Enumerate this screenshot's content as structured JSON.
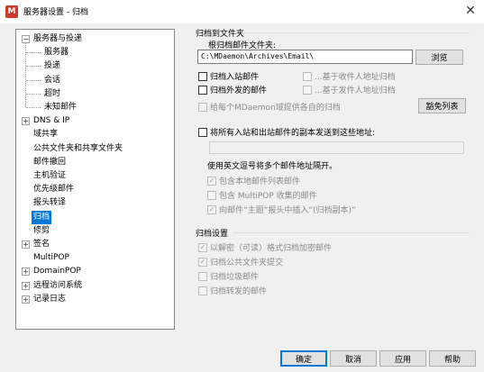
{
  "window": {
    "title": "服务器设置 - 归档",
    "app_icon_glyph": "M",
    "close_glyph": "✕"
  },
  "tree": {
    "expand_glyph": "+",
    "collapse_glyph": "−",
    "items": [
      {
        "label": "服务器与投递",
        "level": 0,
        "expander": "collapse"
      },
      {
        "label": "服务器",
        "level": 1,
        "expander": "none"
      },
      {
        "label": "投递",
        "level": 1,
        "expander": "none"
      },
      {
        "label": "会话",
        "level": 1,
        "expander": "none"
      },
      {
        "label": "超时",
        "level": 1,
        "expander": "none"
      },
      {
        "label": "未知邮件",
        "level": 1,
        "expander": "none"
      },
      {
        "label": "DNS & IP",
        "level": 0,
        "expander": "expand"
      },
      {
        "label": "域共享",
        "level": 0,
        "expander": "none"
      },
      {
        "label": "公共文件夹和共享文件夹",
        "level": 0,
        "expander": "none"
      },
      {
        "label": "邮件撤回",
        "level": 0,
        "expander": "none"
      },
      {
        "label": "主机验证",
        "level": 0,
        "expander": "none"
      },
      {
        "label": "优先级邮件",
        "level": 0,
        "expander": "none"
      },
      {
        "label": "报头转译",
        "level": 0,
        "expander": "none"
      },
      {
        "label": "归档",
        "level": 0,
        "expander": "none",
        "selected": true
      },
      {
        "label": "修剪",
        "level": 0,
        "expander": "none"
      },
      {
        "label": "签名",
        "level": 0,
        "expander": "expand"
      },
      {
        "label": "MultiPOP",
        "level": 0,
        "expander": "none"
      },
      {
        "label": "DomainPOP",
        "level": 0,
        "expander": "expand"
      },
      {
        "label": "远程访问系统",
        "level": 0,
        "expander": "expand"
      },
      {
        "label": "记录日志",
        "level": 0,
        "expander": "expand"
      }
    ]
  },
  "archive_folder": {
    "group_title": "归档到文件夹",
    "root_label": "根归档邮件文件夹:",
    "root_value": "C:\\MDaemon\\Archives\\Email\\",
    "browse_button": "浏览",
    "archive_inbound": {
      "label": "归档入站邮件",
      "checked": false
    },
    "archive_outbound": {
      "label": "归档外发的邮件",
      "checked": false
    },
    "by_recipient": {
      "label": "...基于收件人地址归档",
      "checked": false
    },
    "by_sender": {
      "label": "...基于发件人地址归档",
      "checked": false
    },
    "per_domain": {
      "label": "给每个MDaemon域提供各自的归档",
      "checked": false
    },
    "exempt_button": "豁免列表"
  },
  "send_copies": {
    "label": "将所有入站和出站邮件的副本发送到这些地址:",
    "checked": false,
    "addresses_value": "",
    "separator_note": "使用英文逗号将多个邮件地址隔开。",
    "include_local_list": {
      "label": "包含本地邮件列表邮件",
      "checked": true
    },
    "include_multipop": {
      "label": "包含 MultiPOP 收集的邮件",
      "checked": false
    },
    "insert_subject": {
      "label": "向邮件“主题”报头中插入“(归档副本)”",
      "checked": true
    }
  },
  "archive_settings": {
    "group_title": "归档设置",
    "decrypted_form": {
      "label": "以解密（可读）格式归档加密邮件",
      "checked": true
    },
    "archive_public_folder": {
      "label": "归档公共文件夹提交",
      "checked": true
    },
    "archive_spam": {
      "label": "归档垃圾邮件",
      "checked": false
    },
    "archive_forwarded": {
      "label": "归档转发的邮件",
      "checked": false
    }
  },
  "buttons": {
    "ok": "确定",
    "cancel": "取消",
    "apply": "应用",
    "help": "帮助"
  },
  "check_glyph": "✓"
}
